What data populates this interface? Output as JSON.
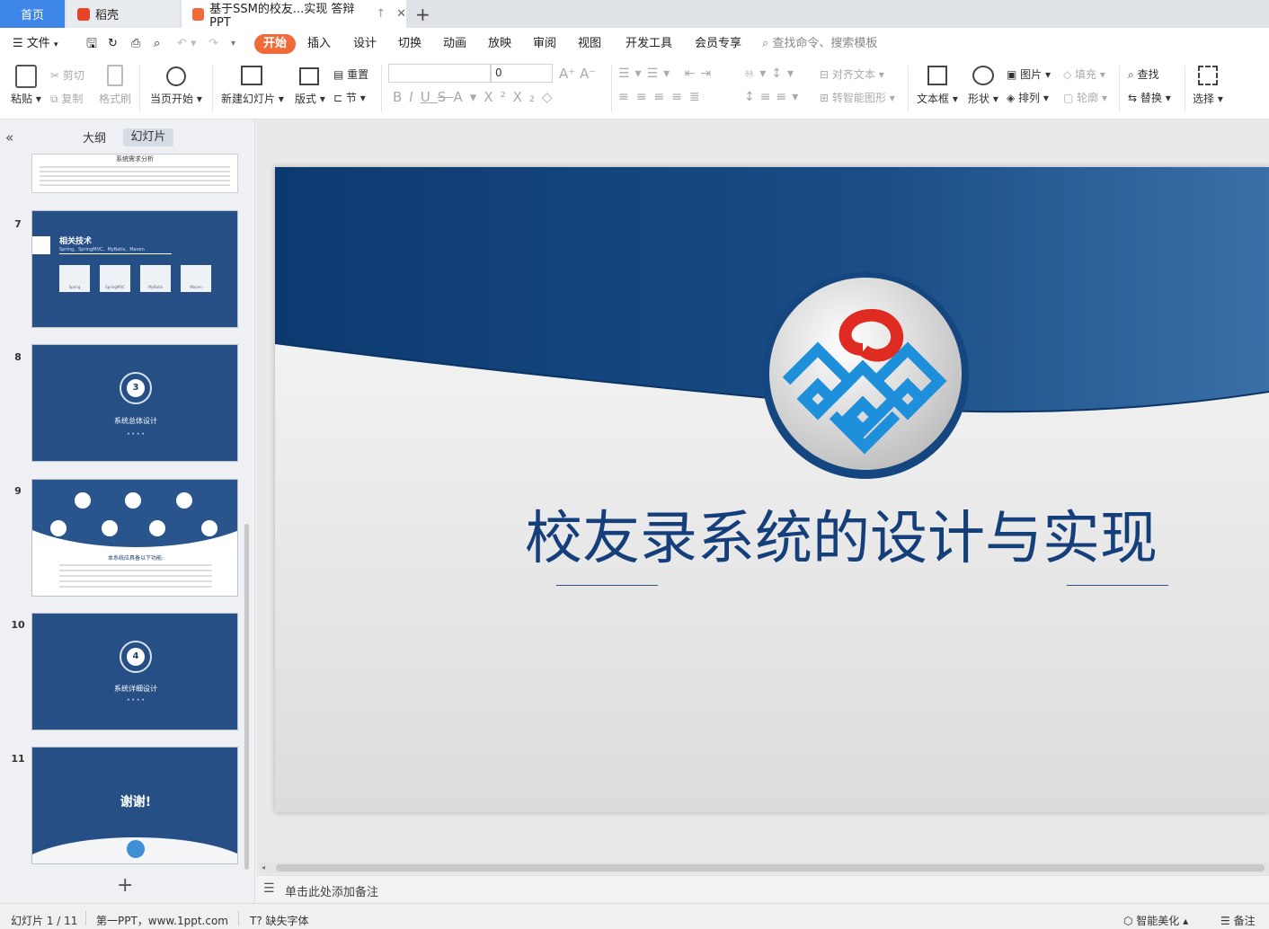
{
  "tabs": {
    "home": "首页",
    "daoke": "稻壳",
    "doc": "基于SSM的校友...实现 答辩PPT"
  },
  "menu": {
    "file": "文件",
    "start": "开始",
    "insert": "插入",
    "design": "设计",
    "transition": "切换",
    "animation": "动画",
    "slideshow": "放映",
    "review": "审阅",
    "view": "视图",
    "devtools": "开发工具",
    "member": "会员专享",
    "search": "查找命令、搜索模板"
  },
  "toolbar": {
    "paste": "粘贴",
    "cut": "剪切",
    "copy": "复制",
    "format_painter": "格式刷",
    "from_current": "当页开始",
    "new_slide": "新建幻灯片",
    "layout": "版式",
    "reset": "重置",
    "section": "节",
    "font_size": "0",
    "align_text": "对齐文本",
    "smart_art": "转智能图形",
    "textbox": "文本框",
    "shape": "形状",
    "picture": "图片",
    "arrange": "排列",
    "fill": "填充",
    "outline": "轮廓",
    "find": "查找",
    "replace": "替换",
    "select": "选择"
  },
  "panel": {
    "outline": "大纲",
    "slides": "幻灯片"
  },
  "slides": [
    {
      "num": "7",
      "title": "相关技术",
      "subtitle": "Spring、SpringMVC、MyBatis、Maven",
      "items": [
        "Spring",
        "SpringMVC",
        "MyBatis",
        "Maven"
      ]
    },
    {
      "num": "8",
      "badge": "3",
      "title": "系统总体设计"
    },
    {
      "num": "9",
      "caption": "本系统应具备以下功能:"
    },
    {
      "num": "10",
      "badge": "4",
      "title": "系统详细设计"
    },
    {
      "num": "11",
      "title": "谢谢!"
    }
  ],
  "slide_prev_title": "系统需求分析",
  "main_slide": {
    "title": "校友录系统的设计与实现"
  },
  "notes": "单击此处添加备注",
  "status": {
    "slide_info": "幻灯片 1 / 11",
    "template": "第一PPT，www.1ppt.com",
    "missing_font": "缺失字体",
    "beautify": "智能美化",
    "notes_btn": "备注"
  },
  "colors": {
    "accent": "#3f86e9",
    "start": "#f06a3a",
    "slide_blue": "#0d3f78",
    "title_blue": "#143f7a"
  }
}
